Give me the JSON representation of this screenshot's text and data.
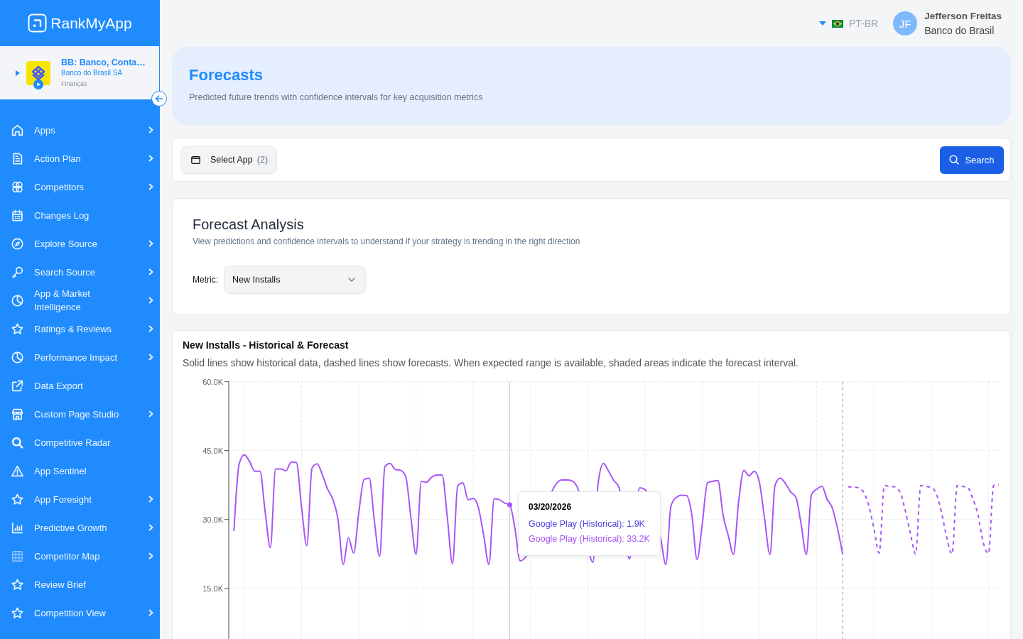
{
  "sidebar": {
    "brand": "RankMyApp",
    "app": {
      "name": "BB: Banco, Conta…",
      "publisher": "Banco do Brasil SA",
      "category": "Finanças",
      "expanded": false
    },
    "items": [
      {
        "label": "Apps",
        "expandable": true
      },
      {
        "label": "Action Plan",
        "expandable": true
      },
      {
        "label": "Competitors",
        "expandable": true
      },
      {
        "label": "Changes Log",
        "expandable": false
      },
      {
        "label": "Explore Source",
        "expandable": true
      },
      {
        "label": "Search Source",
        "expandable": true
      },
      {
        "label": "App & Market Intelligence",
        "expandable": true
      },
      {
        "label": "Ratings & Reviews",
        "expandable": true
      },
      {
        "label": "Performance Impact",
        "expandable": true
      },
      {
        "label": "Data Export",
        "expandable": false
      },
      {
        "label": "Custom Page Studio",
        "expandable": true
      },
      {
        "label": "Competitive Radar",
        "expandable": false
      },
      {
        "label": "App Sentinel",
        "expandable": false
      },
      {
        "label": "App Foresight",
        "expandable": true
      },
      {
        "label": "Predictive Growth",
        "expandable": true
      },
      {
        "label": "Competitor Map",
        "expandable": true
      },
      {
        "label": "Review Brief",
        "expandable": false
      },
      {
        "label": "Competition View",
        "expandable": true
      }
    ]
  },
  "topbar": {
    "language": "PT-BR",
    "user": {
      "initials": "JF",
      "name": "Jefferson Freitas",
      "organization": "Banco do Brasil"
    }
  },
  "page_header": {
    "title": "Forecasts",
    "subtitle": "Predicted future trends with confidence intervals for key acquisition metrics"
  },
  "toolbar": {
    "select_app": {
      "label": "Select App",
      "count": "(2)"
    },
    "search": {
      "label": "Search"
    }
  },
  "analysis": {
    "title": "Forecast Analysis",
    "subtitle": "View predictions and confidence intervals to understand if your strategy is trending in the right direction",
    "metric": {
      "label": "Metric:",
      "value": "New Installs"
    }
  },
  "chart_panel": {
    "title": "New Installs - Historical & Forecast",
    "description": "Solid lines show historical data, dashed lines show forecasts. When expected range is available, shaded areas indicate the forecast interval.",
    "chart_data": {
      "type": "line",
      "grid": true,
      "ylim": [
        4000,
        60000
      ],
      "yticks": [
        {
          "value": 15000,
          "label": "15.0K"
        },
        {
          "value": 30000,
          "label": "30.0K"
        },
        {
          "value": 45000,
          "label": "45.0K"
        },
        {
          "value": 60000,
          "label": "60.0K"
        }
      ],
      "categories": [
        null,
        null,
        null,
        null,
        null,
        null,
        null,
        null,
        null,
        null,
        null,
        null,
        null,
        null,
        null,
        null,
        null,
        null,
        null,
        null,
        null,
        null,
        null,
        null,
        null,
        null,
        null,
        null,
        null,
        null,
        null,
        null,
        null,
        null,
        null,
        null,
        null,
        null,
        null,
        null,
        null,
        null,
        null,
        null,
        null,
        null,
        null,
        null,
        null,
        null,
        null,
        null,
        null,
        null,
        null,
        null,
        null,
        null,
        null,
        null,
        null,
        null,
        null,
        null,
        null,
        null,
        null,
        null,
        null,
        null,
        null,
        null,
        null,
        null,
        null,
        null,
        null,
        null,
        null,
        null,
        null,
        null,
        null,
        null,
        null,
        null,
        null,
        null,
        null,
        null,
        null,
        null,
        null,
        null,
        null,
        null,
        null,
        null,
        null,
        null,
        null,
        null,
        null,
        null,
        null,
        null,
        null,
        null,
        null,
        null,
        null,
        null,
        null,
        null,
        null,
        null,
        null,
        null,
        null,
        null,
        null,
        null,
        null,
        null,
        null,
        null,
        null,
        null,
        null,
        null,
        null,
        null,
        null,
        null,
        null,
        null,
        null,
        null,
        null,
        null,
        null,
        null,
        null,
        null,
        null,
        null,
        null,
        null
      ],
      "series": [
        {
          "color": "#a855f7",
          "line_style": "solid",
          "values": [
            27500,
            42100,
            44100,
            42600,
            40500,
            40500,
            31600,
            23900,
            41000,
            41000,
            40600,
            42500,
            42400,
            32600,
            24300,
            41200,
            42100,
            39700,
            36600,
            34400,
            30000,
            20200,
            26000,
            22700,
            31600,
            38700,
            39000,
            29500,
            22000,
            41500,
            42200,
            40900,
            40700,
            39400,
            30500,
            22400,
            38300,
            38100,
            39200,
            39700,
            39700,
            30500,
            20400,
            37300,
            38000,
            34300,
            34600,
            32500,
            26500,
            20200,
            34500,
            34300,
            33600,
            33200,
            28000,
            21000,
            null,
            null,
            null,
            null,
            null,
            null,
            null,
            38600,
            38600,
            38400,
            37000,
            null,
            null,
            20700,
            38000,
            42200,
            40500,
            38500,
            37000,
            null,
            21500,
            null,
            36900,
            36500,
            null,
            null,
            26000,
            20200,
            33000,
            34800,
            35300,
            35200,
            31000,
            21300,
            29000,
            38000,
            38300,
            38500,
            31000,
            26500,
            22400,
            34000,
            40700,
            39500,
            40500,
            38000,
            30000,
            22400,
            37500,
            39000,
            37800,
            36000,
            34800,
            29000,
            22400,
            35500,
            36600,
            37200,
            34400,
            32500,
            28000,
            22400,
            null,
            null,
            null,
            null,
            null,
            null,
            null,
            null,
            null,
            null,
            null,
            null,
            null,
            null,
            null,
            null,
            null,
            null,
            null,
            null,
            null,
            null,
            null,
            null,
            null,
            null,
            null,
            null,
            null,
            null
          ]
        },
        {
          "color": "#a855f7",
          "line_style": "dashed",
          "values": [
            null,
            null,
            null,
            null,
            null,
            null,
            null,
            null,
            null,
            null,
            null,
            null,
            null,
            null,
            null,
            null,
            null,
            null,
            null,
            null,
            null,
            null,
            null,
            null,
            null,
            null,
            null,
            null,
            null,
            null,
            null,
            null,
            null,
            null,
            null,
            null,
            null,
            null,
            null,
            null,
            null,
            null,
            null,
            null,
            null,
            null,
            null,
            null,
            null,
            null,
            null,
            null,
            null,
            null,
            null,
            null,
            null,
            null,
            null,
            null,
            null,
            null,
            null,
            null,
            null,
            null,
            null,
            null,
            null,
            null,
            null,
            null,
            null,
            null,
            null,
            null,
            null,
            null,
            null,
            null,
            null,
            null,
            null,
            null,
            null,
            null,
            null,
            null,
            null,
            null,
            null,
            null,
            null,
            null,
            null,
            null,
            null,
            null,
            null,
            null,
            null,
            null,
            null,
            null,
            null,
            null,
            null,
            null,
            null,
            null,
            null,
            null,
            null,
            null,
            null,
            null,
            null,
            null,
            37100,
            37100,
            36900,
            36000,
            33000,
            28000,
            22700,
            37400,
            37200,
            37100,
            36000,
            32000,
            27000,
            22500,
            37400,
            37200,
            37000,
            35500,
            31500,
            26000,
            22500,
            37400,
            37200,
            37000,
            34500,
            31000,
            25000,
            22600,
            37400,
            37500
          ]
        }
      ]
    },
    "tooltip": {
      "title": "03/20/2026",
      "entries": [
        {
          "text": "Google Play (Historical): 1.9K",
          "color": "#4f46e5"
        },
        {
          "text": "Google Play (Historical): 33.2K",
          "color": "#a855f7"
        }
      ]
    }
  }
}
